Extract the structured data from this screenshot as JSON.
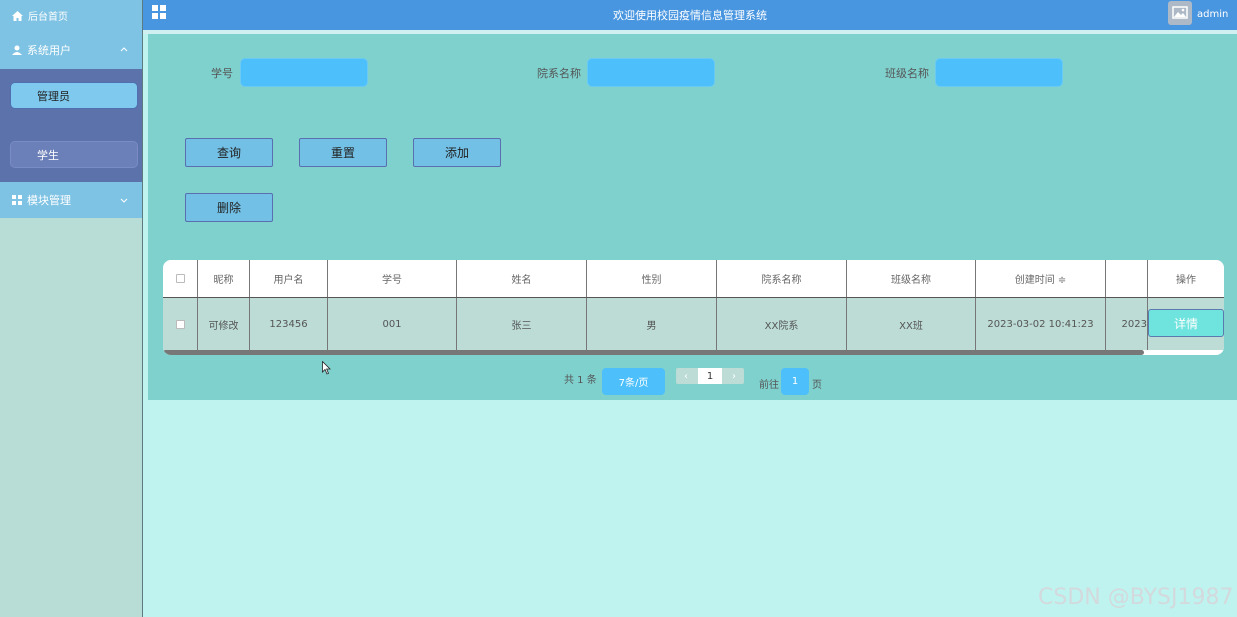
{
  "sidebar": {
    "home": "后台首页",
    "group_users": "系统用户",
    "items": [
      {
        "label": "管理员"
      },
      {
        "label": "学生"
      }
    ],
    "group_modules": "模块管理"
  },
  "header": {
    "title": "欢迎使用校园疫情信息管理系统",
    "user": "admin"
  },
  "filters": {
    "student_no": {
      "label": "学号",
      "value": ""
    },
    "department": {
      "label": "院系名称",
      "value": ""
    },
    "class_name": {
      "label": "班级名称",
      "value": ""
    }
  },
  "buttons": {
    "query": "查询",
    "reset": "重置",
    "add": "添加",
    "delete": "删除"
  },
  "table": {
    "headers": [
      "昵称",
      "用户名",
      "学号",
      "姓名",
      "性别",
      "院系名称",
      "班级名称",
      "创建时间 ≑",
      "操作"
    ],
    "rows": [
      {
        "nickname": "可修改",
        "username": "123456",
        "student_no": "001",
        "name": "张三",
        "gender": "男",
        "department": "XX院系",
        "class_name": "XX班",
        "created": "2023-03-02 10:41:23",
        "updated_partial": "2023",
        "action": "详情"
      }
    ]
  },
  "pagination": {
    "total": "共 1 条",
    "page_size": "7条/页",
    "current_page": "1",
    "goto_label": "前往",
    "goto_value": "1",
    "page_suffix": "页"
  },
  "watermark": "CSDN @BYSJ1987",
  "colors": {
    "header": "#4996e0",
    "sidebar_group": "#7fc3e4",
    "panel": "#7fd1ce",
    "input": "#4dc0fb"
  }
}
